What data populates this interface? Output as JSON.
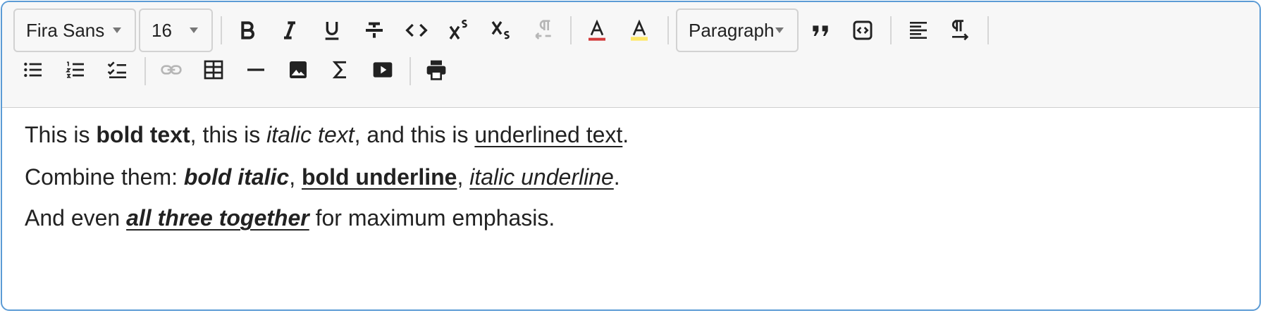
{
  "toolbar": {
    "font_family": "Fira Sans",
    "font_size": "16",
    "block_format": "Paragraph"
  },
  "colors": {
    "text_color_indicator": "#d33b3b",
    "highlight_indicator": "#ffe866",
    "border_accent": "#5b9bd5"
  },
  "icons": {
    "row1": [
      "bold-icon",
      "italic-icon",
      "underline-icon",
      "strikethrough-icon",
      "code-icon",
      "superscript-icon",
      "subscript-icon",
      "paragraph-rtl-icon",
      "text-color-icon",
      "highlight-color-icon",
      "blockquote-icon",
      "code-block-icon",
      "align-left-icon",
      "paragraph-ltr-icon"
    ],
    "row2": [
      "bullet-list-icon",
      "numbered-list-icon",
      "checklist-icon",
      "link-icon",
      "table-icon",
      "horizontal-rule-icon",
      "image-icon",
      "sigma-icon",
      "video-icon",
      "print-icon"
    ]
  },
  "content": {
    "line1": {
      "t1": "This is ",
      "bold": "bold text",
      "t2": ", this is ",
      "italic": "italic text",
      "t3": ", and this is ",
      "underline": "underlined text",
      "t4": "."
    },
    "line2": {
      "t1": "Combine them: ",
      "bold_italic": "bold italic",
      "c1": ", ",
      "bold_underline": "bold underline",
      "c2": ", ",
      "italic_underline": "italic underline",
      "t2": "."
    },
    "line3": {
      "t1": "And even ",
      "all_three": "all three together",
      "t2": " for maximum emphasis."
    }
  }
}
